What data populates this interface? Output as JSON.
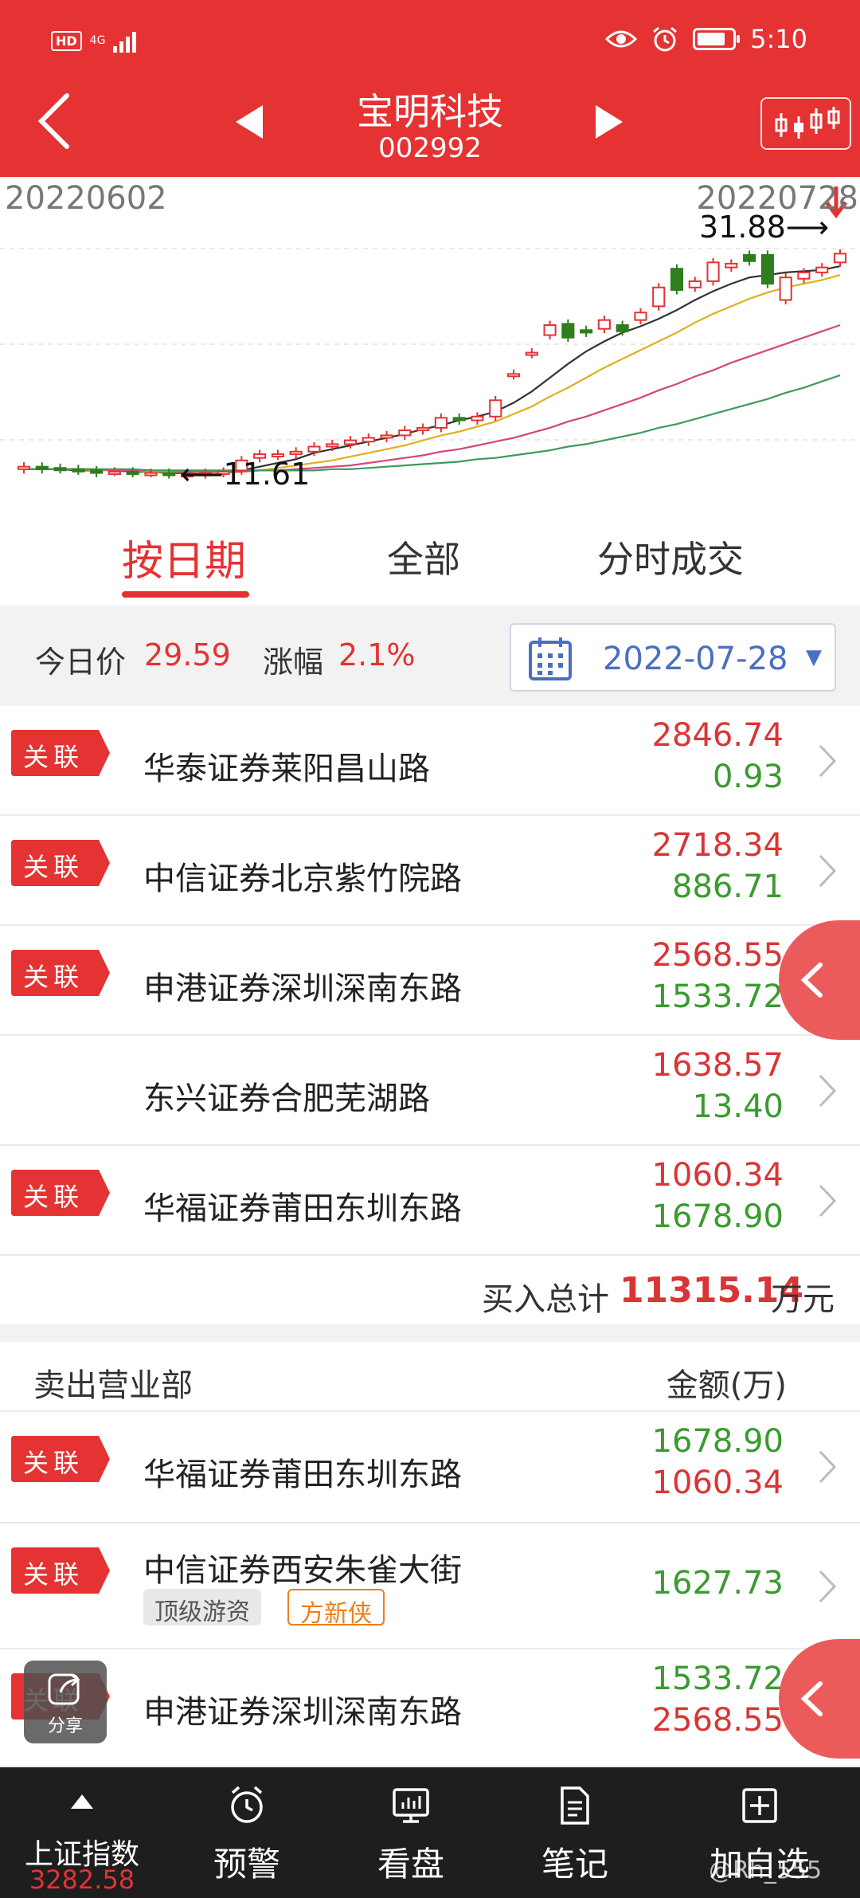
{
  "status_bar": {
    "network": "HD",
    "signal": "4G",
    "time": "5:10"
  },
  "header": {
    "stock_name": "宝明科技",
    "stock_code": "002992"
  },
  "chart_data": {
    "type": "candlestick",
    "start_date": "20220602",
    "end_date": "20220728",
    "high_marker": "31.88⟶",
    "low_marker": "⟵11.61",
    "high_value": 31.88,
    "low_value": 11.61,
    "candles": [
      {
        "o": 12.1,
        "c": 12.3
      },
      {
        "o": 12.3,
        "c": 12.1
      },
      {
        "o": 12.2,
        "c": 12.1
      },
      {
        "o": 12.1,
        "c": 12.0
      },
      {
        "o": 12.0,
        "c": 11.8
      },
      {
        "o": 11.9,
        "c": 11.9
      },
      {
        "o": 11.9,
        "c": 11.8
      },
      {
        "o": 11.8,
        "c": 11.8
      },
      {
        "o": 11.8,
        "c": 11.7
      },
      {
        "o": 11.7,
        "c": 11.7
      },
      {
        "o": 11.7,
        "c": 11.8
      },
      {
        "o": 11.8,
        "c": 11.9
      },
      {
        "o": 12.0,
        "c": 12.8
      },
      {
        "o": 13.0,
        "c": 13.3
      },
      {
        "o": 13.2,
        "c": 13.3
      },
      {
        "o": 13.3,
        "c": 13.5
      },
      {
        "o": 13.5,
        "c": 13.9
      },
      {
        "o": 13.9,
        "c": 14.1
      },
      {
        "o": 14.1,
        "c": 14.4
      },
      {
        "o": 14.3,
        "c": 14.6
      },
      {
        "o": 14.6,
        "c": 14.8
      },
      {
        "o": 14.8,
        "c": 15.2
      },
      {
        "o": 15.2,
        "c": 15.4
      },
      {
        "o": 15.4,
        "c": 16.2
      },
      {
        "o": 16.2,
        "c": 16.0
      },
      {
        "o": 16.0,
        "c": 16.3
      },
      {
        "o": 16.3,
        "c": 17.6
      },
      {
        "o": 19.6,
        "c": 19.7
      },
      {
        "o": 21.3,
        "c": 21.4
      },
      {
        "o": 22.8,
        "c": 23.6
      },
      {
        "o": 23.7,
        "c": 22.6
      },
      {
        "o": 23.2,
        "c": 23.0
      },
      {
        "o": 23.3,
        "c": 24.0
      },
      {
        "o": 23.6,
        "c": 23.1
      },
      {
        "o": 24.0,
        "c": 24.6
      },
      {
        "o": 25.1,
        "c": 26.6
      },
      {
        "o": 28.1,
        "c": 26.4
      },
      {
        "o": 26.6,
        "c": 27.1
      },
      {
        "o": 27.1,
        "c": 28.6
      },
      {
        "o": 28.2,
        "c": 28.5
      },
      {
        "o": 29.2,
        "c": 28.7
      },
      {
        "o": 29.2,
        "c": 26.9
      },
      {
        "o": 25.6,
        "c": 27.4
      },
      {
        "o": 27.3,
        "c": 27.8
      },
      {
        "o": 27.8,
        "c": 28.2
      },
      {
        "o": 28.6,
        "c": 29.3
      }
    ],
    "ma_lines": [
      {
        "color": "#333333",
        "values": [
          12.1,
          12.1,
          12.1,
          12.0,
          12.0,
          12.0,
          11.9,
          11.9,
          11.8,
          11.8,
          11.8,
          11.8,
          12.0,
          12.3,
          12.6,
          12.9,
          13.4,
          13.7,
          14.0,
          14.3,
          14.6,
          14.9,
          15.3,
          15.6,
          16.0,
          16.3,
          16.7,
          17.4,
          18.3,
          19.4,
          20.5,
          21.5,
          22.3,
          23.0,
          23.5,
          24.1,
          24.8,
          25.6,
          26.3,
          26.9,
          27.4,
          27.6,
          27.8,
          27.9,
          28.0,
          28.3
        ]
      },
      {
        "color": "#e0b020",
        "values": [
          12.1,
          12.1,
          12.1,
          12.1,
          12.0,
          12.0,
          12.0,
          11.9,
          11.9,
          11.9,
          11.8,
          11.8,
          11.9,
          12.0,
          12.2,
          12.4,
          12.6,
          12.8,
          13.1,
          13.4,
          13.7,
          14.0,
          14.4,
          14.8,
          15.1,
          15.5,
          15.9,
          16.5,
          17.1,
          17.9,
          18.6,
          19.4,
          20.2,
          20.9,
          21.6,
          22.3,
          23.0,
          23.8,
          24.5,
          25.1,
          25.7,
          26.2,
          26.6,
          26.9,
          27.2,
          27.6
        ]
      },
      {
        "color": "#d6457a",
        "values": [
          12.1,
          12.1,
          12.1,
          12.1,
          12.1,
          12.0,
          12.0,
          12.0,
          12.0,
          11.9,
          11.9,
          11.9,
          11.9,
          12.0,
          12.0,
          12.1,
          12.2,
          12.3,
          12.4,
          12.6,
          12.8,
          13.0,
          13.2,
          13.5,
          13.7,
          14.0,
          14.3,
          14.6,
          15.0,
          15.4,
          15.9,
          16.3,
          16.8,
          17.3,
          17.8,
          18.4,
          18.9,
          19.5,
          20.0,
          20.6,
          21.1,
          21.6,
          22.1,
          22.6,
          23.1,
          23.6
        ]
      },
      {
        "color": "#3c9a5f",
        "values": [
          12.1,
          12.1,
          12.1,
          12.1,
          12.1,
          12.1,
          12.1,
          12.0,
          12.0,
          12.0,
          12.0,
          12.0,
          12.0,
          12.0,
          12.0,
          12.0,
          12.0,
          12.1,
          12.1,
          12.2,
          12.3,
          12.4,
          12.5,
          12.6,
          12.7,
          12.9,
          13.0,
          13.2,
          13.4,
          13.6,
          13.9,
          14.1,
          14.4,
          14.7,
          15.0,
          15.4,
          15.7,
          16.1,
          16.5,
          16.9,
          17.3,
          17.7,
          18.2,
          18.6,
          19.1,
          19.6
        ]
      }
    ]
  },
  "tabs": [
    "按日期",
    "全部",
    "分时成交"
  ],
  "info": {
    "today_price_label": "今日价",
    "today_price": "29.59",
    "change_label": "涨幅",
    "change": "2.1%",
    "date": "2022-07-28"
  },
  "tag_label": "关联",
  "buy_rows": [
    {
      "broker": "华泰证券莱阳昌山路",
      "v1": "2846.74",
      "v2": "0.93",
      "tag": true
    },
    {
      "broker": "中信证券北京紫竹院路",
      "v1": "2718.34",
      "v2": "886.71",
      "tag": true
    },
    {
      "broker": "申港证券深圳深南东路",
      "v1": "2568.55",
      "v2": "1533.72",
      "tag": true
    },
    {
      "broker": "东兴证券合肥芜湖路",
      "v1": "1638.57",
      "v2": "13.40",
      "tag": false
    },
    {
      "broker": "华福证券莆田东圳东路",
      "v1": "1060.34",
      "v2": "1678.90",
      "tag": true
    }
  ],
  "buy_total": {
    "label": "买入总计",
    "value": "11315.14",
    "unit": "万元"
  },
  "sell_header": {
    "left": "卖出营业部",
    "right": "金额(万)"
  },
  "sell_rows": [
    {
      "broker": "华福证券莆田东圳东路",
      "v1": "1678.90",
      "v2": "1060.34"
    },
    {
      "broker": "中信证券西安朱雀大街",
      "v1": "1627.73",
      "chips": [
        "顶级游资",
        "方新侠"
      ]
    },
    {
      "broker": "申港证券深圳深南东路",
      "v1": "1533.72",
      "v2": "2568.55"
    }
  ],
  "share_label": "分享",
  "bottom_nav": {
    "index_name": "上证指数",
    "index_value": "3282.58",
    "items": [
      "预警",
      "看盘",
      "笔记",
      "加自选"
    ]
  },
  "watermark": "@Rh_555",
  "colors": {
    "brand_red": "#e53233",
    "up": "#d93536",
    "down": "#3a9b2f"
  }
}
